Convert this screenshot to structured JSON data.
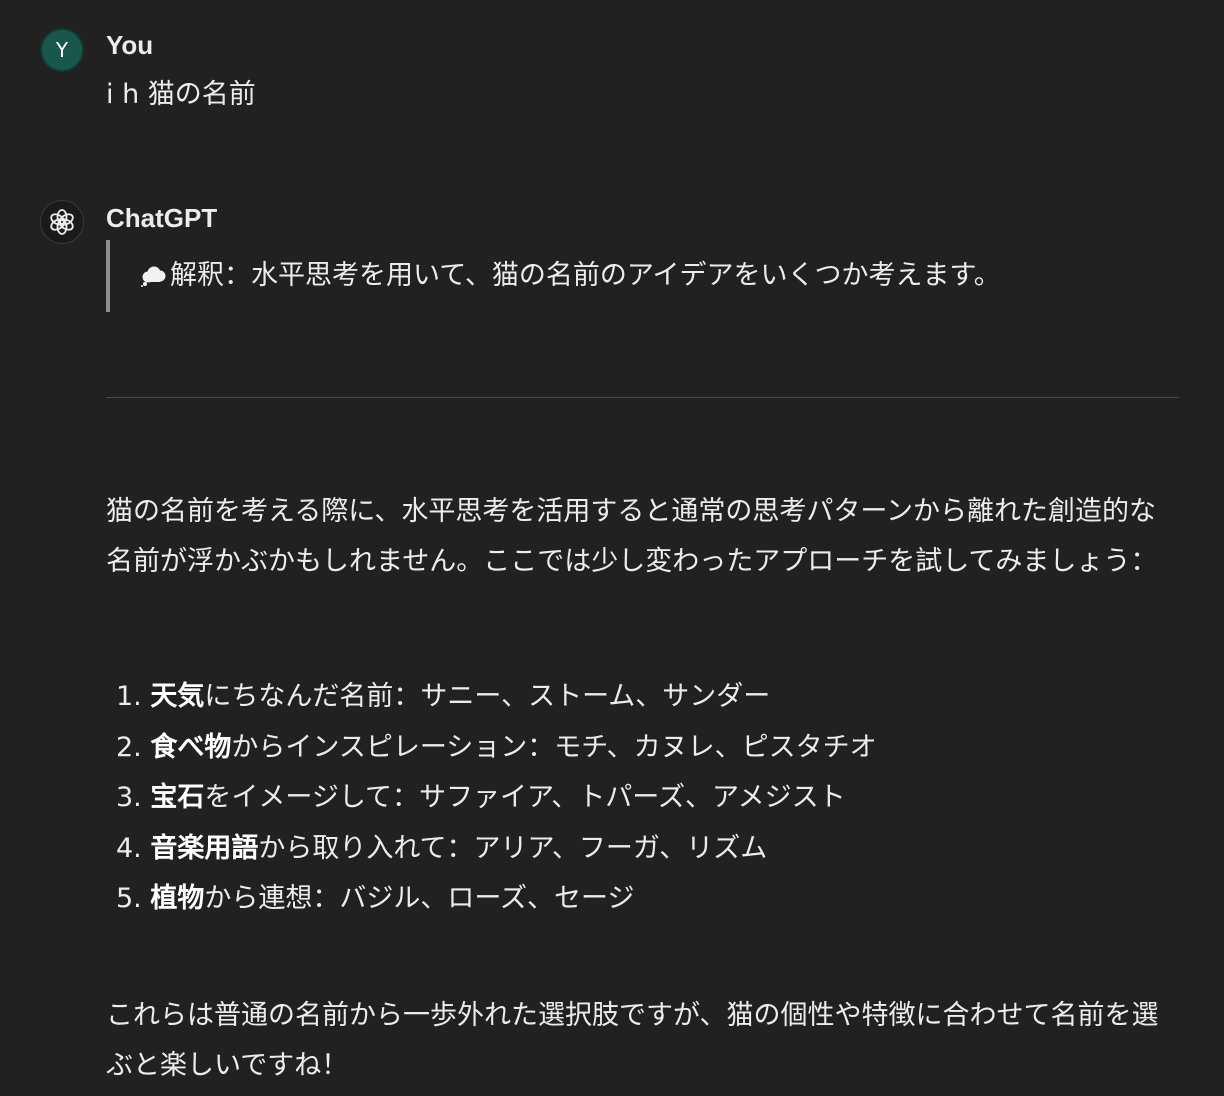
{
  "user": {
    "avatar_letter": "Y",
    "name": "You",
    "message": "i h 猫の名前"
  },
  "assistant": {
    "name": "ChatGPT",
    "icon": "openai-logo-icon",
    "quote_icon": "thought-cloud-icon",
    "quote_text": "解釈：水平思考を用いて、猫の名前のアイデアをいくつか考えます。",
    "intro": "猫の名前を考える際に、水平思考を活用すると通常の思考パターンから離れた創造的な名前が浮かぶかもしれません。ここでは少し変わったアプローチを試してみましょう：",
    "items": [
      {
        "num": "1.",
        "bold": "天気",
        "rest": "にちなんだ名前：サニー、ストーム、サンダー"
      },
      {
        "num": "2.",
        "bold": "食べ物",
        "rest": "からインスピレーション：モチ、カヌレ、ピスタチオ"
      },
      {
        "num": "3.",
        "bold": "宝石",
        "rest": "をイメージして：サファイア、トパーズ、アメジスト"
      },
      {
        "num": "4.",
        "bold": "音楽用語",
        "rest": "から取り入れて：アリア、フーガ、リズム"
      },
      {
        "num": "5.",
        "bold": "植物",
        "rest": "から連想：バジル、ローズ、セージ"
      }
    ],
    "closing": "これらは普通の名前から一歩外れた選択肢ですが、猫の個性や特徴に合わせて名前を選ぶと楽しいですね！"
  },
  "colors": {
    "background": "#212121",
    "text": "#ececec",
    "user_avatar": "#19574a",
    "quote_border": "#8e8e8e"
  }
}
